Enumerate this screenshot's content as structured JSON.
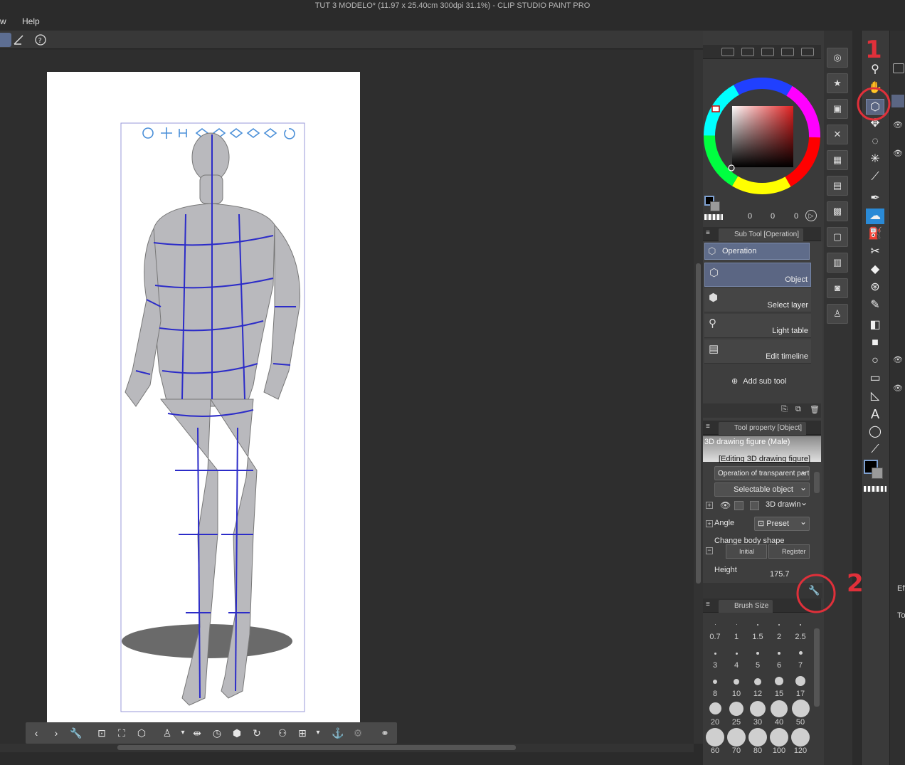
{
  "window": {
    "title": "TUT 3 MODELO* (11.97 x 25.40cm 300dpi 31.1%)  - CLIP STUDIO PAINT PRO"
  },
  "menu": {
    "items": [
      "w",
      "Help"
    ]
  },
  "canvas_toolbar": {
    "icons": [
      "chevron-left-icon",
      "chevron-right-icon",
      "wrench-icon",
      "camera-icon",
      "fit-icon",
      "cube-icon",
      "figure-add-icon",
      "dropdown-icon",
      "flip-icon",
      "rotate-icon",
      "root-icon",
      "revolve-icon",
      "pose-add-icon",
      "pose-icon",
      "dropdown-icon",
      "ground-icon",
      "register-icon",
      "body-shape-icon"
    ]
  },
  "color_panel": {
    "readout": [
      "0",
      "0",
      "0"
    ]
  },
  "sub_tool": {
    "header": "Sub Tool [Operation]",
    "group_label": "Operation",
    "items": [
      "Object",
      "Select layer",
      "Light table",
      "Edit timeline"
    ],
    "add_label": "Add sub tool"
  },
  "tool_property": {
    "header": "Tool property [Object]",
    "figure_name": "3D drawing figure (Male)",
    "editing_label": "[Editing 3D drawing figure]",
    "transparent_dropdown": "Operation of transparent part",
    "selectable_dropdown": "Selectable object",
    "layer_dropdown": "3D drawin",
    "angle_label": "Angle",
    "angle_dropdown": "Preset",
    "body_shape_label": "Change body shape",
    "initial_button": "Initial bod",
    "register_button": "Register",
    "height_label": "Height",
    "height_value": "175.7"
  },
  "brush_size": {
    "header": "Brush Size",
    "sizes": [
      "0.7",
      "1",
      "1.5",
      "2",
      "2.5",
      "3",
      "4",
      "5",
      "6",
      "7",
      "8",
      "10",
      "12",
      "15",
      "17",
      "20",
      "25",
      "30",
      "40",
      "50",
      "60",
      "70",
      "80",
      "100",
      "120"
    ]
  },
  "annotations": {
    "one": "1",
    "two": "2"
  },
  "far_right": {
    "labels": [
      "Eff",
      "To"
    ]
  }
}
